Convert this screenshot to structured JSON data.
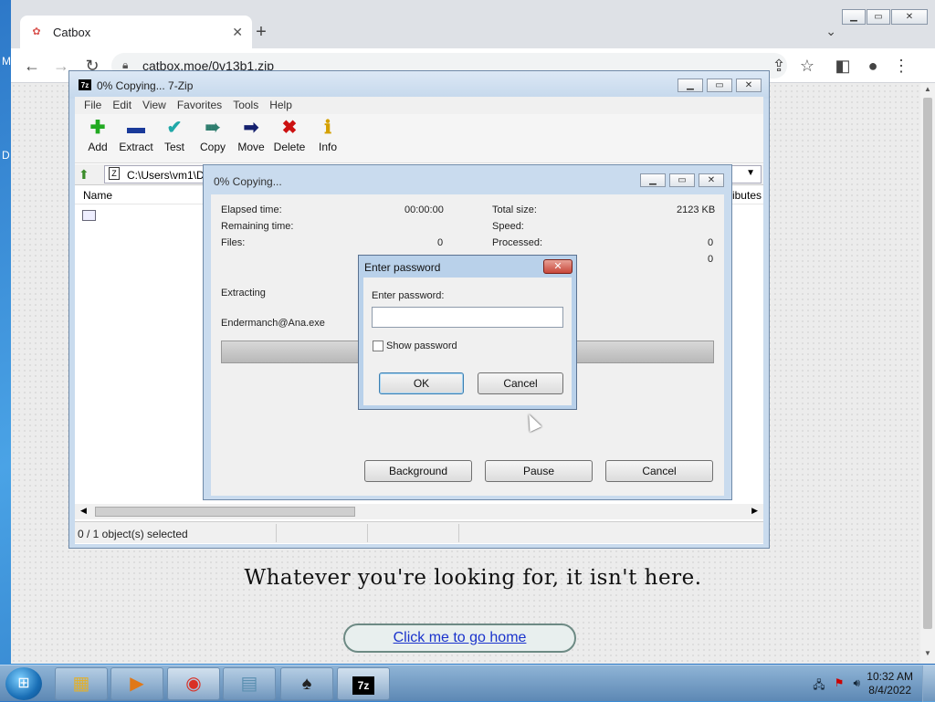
{
  "desktop": {
    "edge_left_top": "M",
    "edge_left_mid": "D"
  },
  "browser": {
    "tab_title": "Catbox",
    "url": "catbox.moe/0v13b1.zip",
    "message": "Whatever you're looking for, it isn't here.",
    "home_link": "Click me to go home"
  },
  "zip": {
    "title": "0% Copying... 7-Zip",
    "menu": [
      "File",
      "Edit",
      "View",
      "Favorites",
      "Tools",
      "Help"
    ],
    "tools": [
      {
        "label": "Add",
        "icon": "plus-icon",
        "color": "#22aa22"
      },
      {
        "label": "Extract",
        "icon": "minus-icon",
        "color": "#1a3a9a"
      },
      {
        "label": "Test",
        "icon": "check-icon",
        "color": "#20a8a8"
      },
      {
        "label": "Copy",
        "icon": "double-arrow-icon",
        "color": "#2e7d6e"
      },
      {
        "label": "Move",
        "icon": "arrow-right-icon",
        "color": "#14206e"
      },
      {
        "label": "Delete",
        "icon": "x-icon",
        "color": "#cc1111"
      },
      {
        "label": "Info",
        "icon": "info-icon",
        "color": "#d4a000"
      }
    ],
    "path": "C:\\Users\\vm1\\D",
    "col_name": "Name",
    "col_attributes": "ributes",
    "status": "0 / 1 object(s) selected"
  },
  "progress": {
    "title": "0% Copying...",
    "elapsed_label": "Elapsed time:",
    "elapsed_value": "00:00:00",
    "remaining_label": "Remaining time:",
    "files_label": "Files:",
    "files_value": "0",
    "total_label": "Total size:",
    "total_value": "2123 KB",
    "speed_label": "Speed:",
    "processed_label": "Processed:",
    "processed_value": "0",
    "extra_value": "0",
    "action": "Extracting",
    "filename": "Endermanch@Ana.exe",
    "progress_fraction": 0,
    "background_label": "Background",
    "pause_label": "Pause",
    "cancel_label": "Cancel"
  },
  "password": {
    "title": "Enter password",
    "prompt": "Enter password:",
    "input_value": "",
    "show_password_label": "Show password",
    "show_password_checked": false,
    "ok_label": "OK",
    "cancel_label": "Cancel"
  },
  "taskbar": {
    "apps": [
      "explorer-icon",
      "media-player-icon",
      "chrome-icon",
      "notepad-icon",
      "solitaire-icon",
      "7zip-icon"
    ],
    "time": "10:32 AM",
    "date": "8/4/2022"
  }
}
